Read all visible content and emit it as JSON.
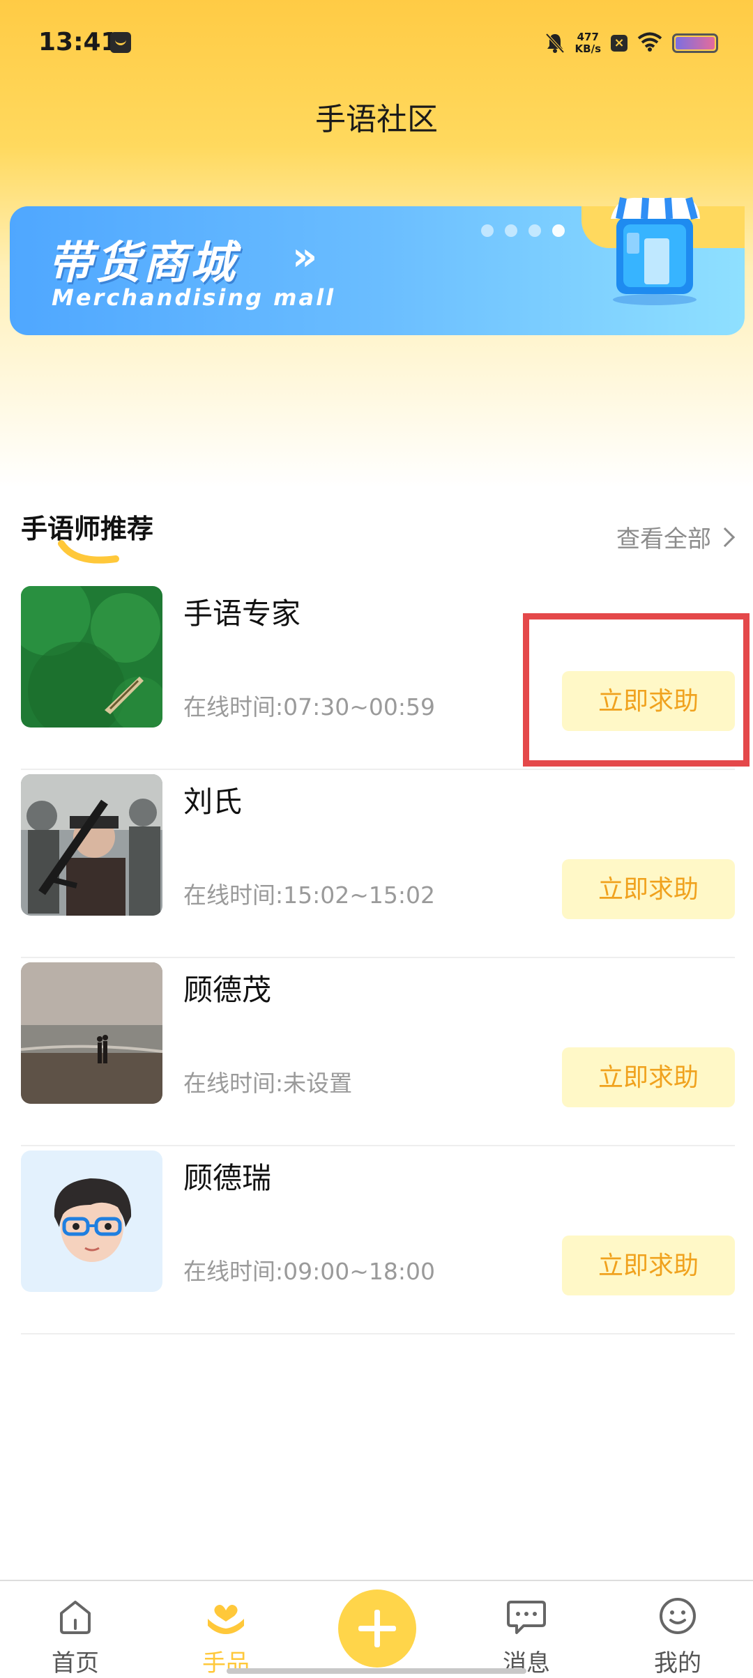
{
  "status_bar": {
    "time": "13:41",
    "net_speed_value": "477",
    "net_speed_unit": "KB/s"
  },
  "header": {
    "title": "手语社区"
  },
  "banner": {
    "title": "带货商城",
    "arrows": "»",
    "subtitle": "Merchandising mall",
    "dots": 4,
    "active_dot": 3
  },
  "section": {
    "title": "手语师推荐",
    "view_all": "查看全部"
  },
  "online_prefix": "在线时间:",
  "experts": [
    {
      "name": "手语专家",
      "online": "在线时间:07:30~00:59",
      "button": "立即求助",
      "avatar": "green-water-boat"
    },
    {
      "name": "刘氏",
      "online": "在线时间:15:02~15:02",
      "button": "立即求助",
      "avatar": "soldiers-game-art"
    },
    {
      "name": "顾德茂",
      "online": "在线时间:未设置",
      "button": "立即求助",
      "avatar": "beach-couple"
    },
    {
      "name": "顾德瑞",
      "online": "在线时间:09:00~18:00",
      "button": "立即求助",
      "avatar": "cartoon-boy-glasses"
    }
  ],
  "tabbar": {
    "items": [
      {
        "label": "首页",
        "icon": "home-icon"
      },
      {
        "label": "手品",
        "icon": "hands-heart-icon",
        "active": true
      },
      {
        "label": "",
        "icon": "plus-icon"
      },
      {
        "label": "消息",
        "icon": "chat-icon"
      },
      {
        "label": "我的",
        "icon": "smile-icon"
      }
    ]
  },
  "colors": {
    "accent": "#FFC83A",
    "button_bg": "#FFF8C7",
    "button_text": "#F0A21E",
    "highlight": "#E4484A"
  }
}
